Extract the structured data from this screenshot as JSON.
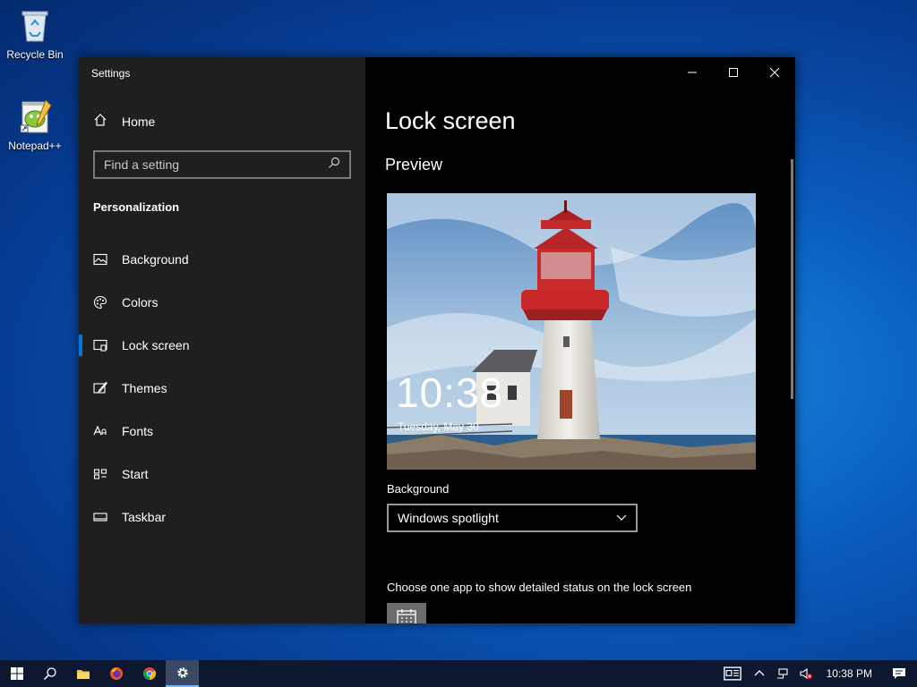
{
  "desktop": {
    "icons": [
      {
        "label": "Recycle Bin"
      },
      {
        "label": "Notepad++"
      }
    ]
  },
  "window": {
    "title": "Settings"
  },
  "sidebar": {
    "home_label": "Home",
    "search_placeholder": "Find a setting",
    "section_title": "Personalization",
    "items": [
      {
        "label": "Background",
        "icon": "image-icon"
      },
      {
        "label": "Colors",
        "icon": "palette-icon"
      },
      {
        "label": "Lock screen",
        "icon": "lock-screen-icon",
        "active": true
      },
      {
        "label": "Themes",
        "icon": "brush-icon"
      },
      {
        "label": "Fonts",
        "icon": "font-icon"
      },
      {
        "label": "Start",
        "icon": "start-icon"
      },
      {
        "label": "Taskbar",
        "icon": "taskbar-icon"
      }
    ]
  },
  "content": {
    "page_title": "Lock screen",
    "preview_title": "Preview",
    "preview_time": "10:38",
    "preview_date": "Tuesday, May 30",
    "background_label": "Background",
    "background_value": "Windows spotlight",
    "choose_app_text": "Choose one app to show detailed status on the lock screen"
  },
  "taskbar": {
    "time": "10:38 PM"
  },
  "colors": {
    "accent": "#0078d7",
    "sidebar_bg": "#1f1f1f",
    "content_bg": "#000000"
  }
}
